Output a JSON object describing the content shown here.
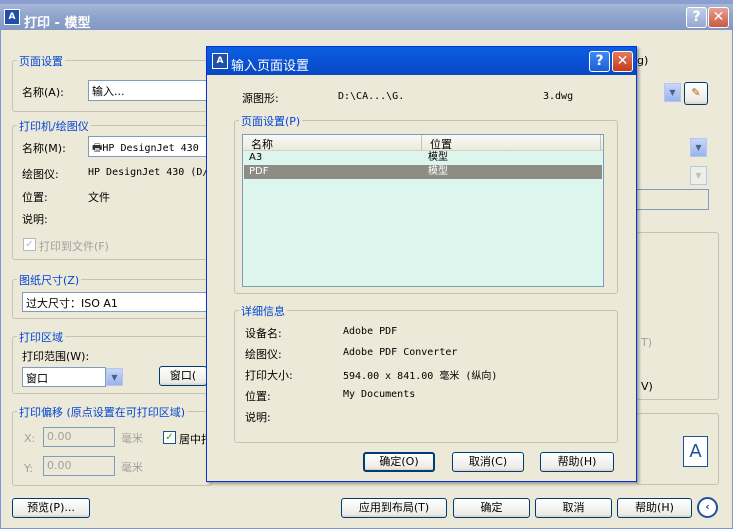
{
  "outer": {
    "title": "打印 - 模型",
    "icon": "autocad-icon",
    "page_setup": {
      "group": "页面设置",
      "name_label": "名称(A):",
      "name_value": "输入...",
      "add_suffix": "g)"
    },
    "printer": {
      "group": "打印机/绘图仪",
      "name_label": "名称(M):",
      "name_value": "HP DesignJet 430",
      "plotter_label": "绘图仪:",
      "plotter_value": "HP DesignJet 430 (D/",
      "location_label": "位置:",
      "location_value": "文件",
      "desc_label": "说明:",
      "print_to_file": "打印到文件(F)"
    },
    "paper": {
      "group": "图纸尺寸(Z)",
      "value": "过大尺寸：ISO A1"
    },
    "area": {
      "group": "打印区域",
      "range_label": "打印范围(W):",
      "range_value": "窗口",
      "window_button": "窗口("
    },
    "offset": {
      "group": "打印偏移 (原点设置在可打印区域)",
      "x_label": "X:",
      "x_value": "0.00",
      "y_label": "Y:",
      "y_value": "0.00",
      "unit": "毫米",
      "center": "居中打"
    },
    "right_fragments": {
      "t_label": "T)",
      "v_label": "V)",
      "preview_letter": "A"
    },
    "bottom": {
      "preview": "预览(P)...",
      "apply": "应用到布局(T)",
      "ok": "确定",
      "cancel": "取消",
      "help": "帮助(H)"
    }
  },
  "dialog": {
    "title": "输入页面设置",
    "source_label": "源图形:",
    "source_path": "D:\\CA...\\G.",
    "source_file": "3.dwg",
    "page_setups_group": "页面设置(P)",
    "columns": [
      "名称",
      "位置"
    ],
    "rows": [
      {
        "name": "A3",
        "location": "模型",
        "selected": false
      },
      {
        "name": "PDF",
        "location": "模型",
        "selected": true
      }
    ],
    "details_group": "详细信息",
    "details": [
      {
        "label": "设备名:",
        "value": "Adobe PDF"
      },
      {
        "label": "绘图仪:",
        "value": "Adobe PDF Converter"
      },
      {
        "label": "打印大小:",
        "value": "594.00 x 841.00 毫米 (纵向)"
      },
      {
        "label": "位置:",
        "value": "My Documents"
      },
      {
        "label": "说明:",
        "value": ""
      }
    ],
    "ok": "确定(O)",
    "cancel": "取消(C)",
    "help": "帮助(H)"
  }
}
